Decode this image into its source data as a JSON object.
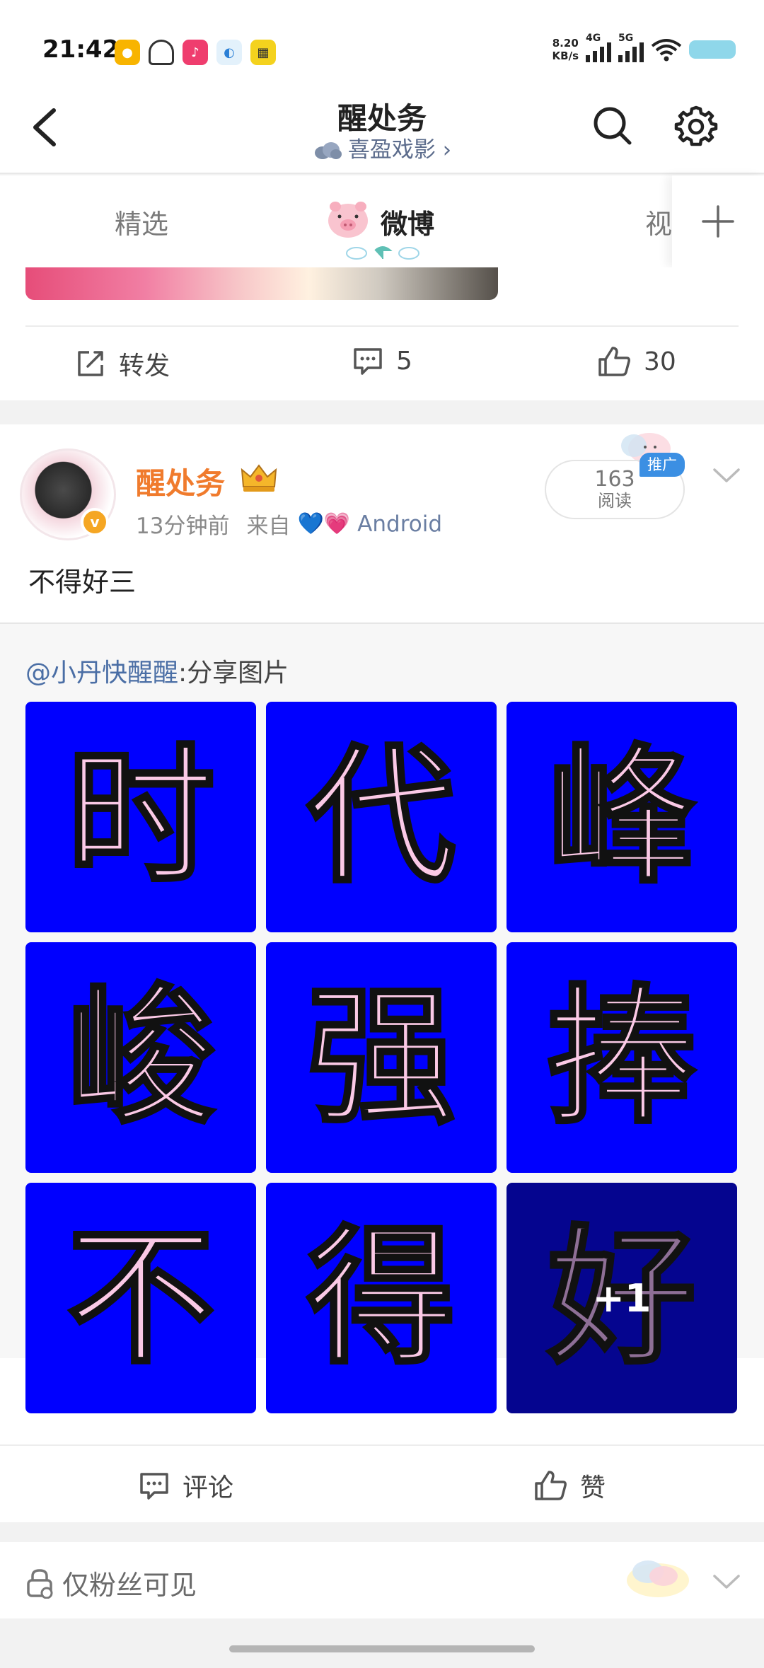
{
  "status_bar": {
    "time": "21:42",
    "net_speed_value": "8.20",
    "net_speed_unit": "KB/s",
    "signal_1": "4G",
    "signal_2": "5G"
  },
  "header": {
    "title": "醒处务",
    "subtitle": "喜盈戏影",
    "subtitle_chevron": "›"
  },
  "tabs": {
    "items": [
      "精选",
      "微博",
      "视"
    ],
    "active_index": 1
  },
  "prev_post": {
    "repost_label": "转发",
    "comment_count": "5",
    "like_count": "30"
  },
  "post": {
    "author": "醒处务",
    "time": "13分钟前",
    "source_prefix": "来自",
    "source_hearts": "💙💗",
    "source_device": "Android",
    "reads_count": "163",
    "reads_label": "阅读",
    "promo_label": "推广",
    "text": "不得好三",
    "repost": {
      "at_user": "@小丹快醒醒",
      "content": ":分享图片",
      "images": [
        "时",
        "代",
        "峰",
        "峻",
        "强",
        "捧",
        "不",
        "得",
        "好"
      ],
      "more_badge": "+1"
    },
    "comment_label": "评论",
    "like_label": "赞"
  },
  "fans_only": {
    "label": "仅粉丝可见"
  },
  "colors": {
    "tile_blue": "#0000ff",
    "tile_text_pink": "#fbc9e6",
    "author_orange": "#f07b2d",
    "link_blue": "#4a6ea5",
    "promo_blue": "#3b8fe3"
  }
}
